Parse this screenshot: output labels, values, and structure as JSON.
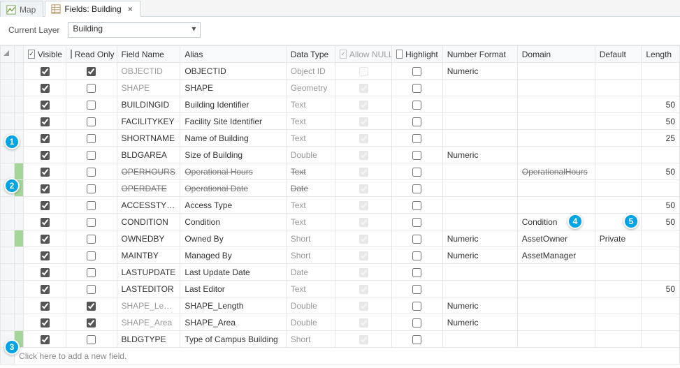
{
  "tabs": [
    {
      "label": "Map",
      "active": false
    },
    {
      "label": "Fields: Building",
      "active": true
    }
  ],
  "layer": {
    "label": "Current Layer",
    "value": "Building"
  },
  "columns": {
    "rowhdr": "",
    "visible": "Visible",
    "readonly": "Read Only",
    "fieldname": "Field Name",
    "alias": "Alias",
    "datatype": "Data Type",
    "allownull": "Allow NULL",
    "highlight": "Highlight",
    "numfmt": "Number Format",
    "domain": "Domain",
    "default": "Default",
    "length": "Length"
  },
  "rows": [
    {
      "gutter": "",
      "visible": true,
      "readonly": true,
      "fieldname": "OBJECTID",
      "alias": "OBJECTID",
      "datatype": "Object ID",
      "allownull": false,
      "allownullDisabled": true,
      "highlight": false,
      "numfmt": "Numeric",
      "domain": "",
      "default": "",
      "length": "",
      "fieldMuted": true,
      "typeMuted": true
    },
    {
      "gutter": "",
      "visible": true,
      "readonly": false,
      "fieldname": "SHAPE",
      "alias": "SHAPE",
      "datatype": "Geometry",
      "allownull": true,
      "allownullDisabled": true,
      "highlight": false,
      "numfmt": "",
      "domain": "",
      "default": "",
      "length": "",
      "fieldMuted": true,
      "typeMuted": true
    },
    {
      "gutter": "",
      "visible": true,
      "readonly": false,
      "fieldname": "BUILDINGID",
      "alias": "Building Identifier",
      "datatype": "Text",
      "allownull": true,
      "allownullDisabled": true,
      "highlight": false,
      "numfmt": "",
      "domain": "",
      "default": "",
      "length": "50",
      "typeMuted": true
    },
    {
      "gutter": "",
      "visible": true,
      "readonly": false,
      "fieldname": "FACILITYKEY",
      "alias": "Facility Site Identifier",
      "datatype": "Text",
      "allownull": true,
      "allownullDisabled": true,
      "highlight": false,
      "numfmt": "",
      "domain": "",
      "default": "",
      "length": "50",
      "typeMuted": true
    },
    {
      "gutter": "",
      "visible": true,
      "readonly": false,
      "fieldname": "SHORTNAME",
      "alias": "Name of Building",
      "datatype": "Text",
      "allownull": true,
      "allownullDisabled": true,
      "highlight": false,
      "numfmt": "",
      "domain": "",
      "default": "",
      "length": "25",
      "typeMuted": true
    },
    {
      "gutter": "",
      "visible": true,
      "readonly": false,
      "fieldname": "BLDGAREA",
      "alias": "Size of Building",
      "datatype": "Double",
      "allownull": true,
      "allownullDisabled": true,
      "highlight": false,
      "numfmt": "Numeric",
      "domain": "",
      "default": "",
      "length": "",
      "typeMuted": true
    },
    {
      "gutter": "green",
      "visible": true,
      "readonly": false,
      "fieldname": "OPERHOURS",
      "alias": "Operational Hours",
      "datatype": "Text",
      "allownull": true,
      "allownullDisabled": true,
      "highlight": false,
      "numfmt": "",
      "domain": "OperationalHours",
      "default": "",
      "length": "50",
      "strike": true
    },
    {
      "gutter": "green",
      "visible": true,
      "readonly": false,
      "fieldname": "OPERDATE",
      "alias": "Operational Date",
      "datatype": "Date",
      "allownull": true,
      "allownullDisabled": true,
      "highlight": false,
      "numfmt": "",
      "domain": "",
      "default": "",
      "length": "",
      "strike": true
    },
    {
      "gutter": "",
      "visible": true,
      "readonly": false,
      "fieldname": "ACCESSTYPE",
      "alias": "Access Type",
      "datatype": "Text",
      "allownull": true,
      "allownullDisabled": true,
      "highlight": false,
      "numfmt": "",
      "domain": "",
      "default": "",
      "length": "50",
      "typeMuted": true
    },
    {
      "gutter": "",
      "visible": true,
      "readonly": false,
      "fieldname": "CONDITION",
      "alias": "Condition",
      "datatype": "Text",
      "allownull": true,
      "allownullDisabled": true,
      "highlight": false,
      "numfmt": "",
      "domain": "Condition",
      "default": "",
      "length": "50",
      "typeMuted": true
    },
    {
      "gutter": "green",
      "visible": true,
      "readonly": false,
      "fieldname": "OWNEDBY",
      "alias": "Owned By",
      "datatype": "Short",
      "allownull": true,
      "allownullDisabled": true,
      "highlight": false,
      "numfmt": "Numeric",
      "domain": "AssetOwner",
      "default": "Private",
      "length": "",
      "typeMuted": true
    },
    {
      "gutter": "",
      "visible": true,
      "readonly": false,
      "fieldname": "MAINTBY",
      "alias": "Managed By",
      "datatype": "Short",
      "allownull": true,
      "allownullDisabled": true,
      "highlight": false,
      "numfmt": "Numeric",
      "domain": "AssetManager",
      "default": "",
      "length": "",
      "typeMuted": true
    },
    {
      "gutter": "",
      "visible": true,
      "readonly": false,
      "fieldname": "LASTUPDATE",
      "alias": "Last Update Date",
      "datatype": "Date",
      "allownull": true,
      "allownullDisabled": true,
      "highlight": false,
      "numfmt": "",
      "domain": "",
      "default": "",
      "length": "",
      "typeMuted": true
    },
    {
      "gutter": "",
      "visible": true,
      "readonly": false,
      "fieldname": "LASTEDITOR",
      "alias": "Last Editor",
      "datatype": "Text",
      "allownull": true,
      "allownullDisabled": true,
      "highlight": false,
      "numfmt": "",
      "domain": "",
      "default": "",
      "length": "50",
      "typeMuted": true
    },
    {
      "gutter": "",
      "visible": true,
      "readonly": true,
      "fieldname": "SHAPE_Length",
      "alias": "SHAPE_Length",
      "datatype": "Double",
      "allownull": true,
      "allownullDisabled": true,
      "highlight": false,
      "numfmt": "Numeric",
      "domain": "",
      "default": "",
      "length": "",
      "fieldMuted": true,
      "typeMuted": true
    },
    {
      "gutter": "",
      "visible": true,
      "readonly": true,
      "fieldname": "SHAPE_Area",
      "alias": "SHAPE_Area",
      "datatype": "Double",
      "allownull": true,
      "allownullDisabled": true,
      "highlight": false,
      "numfmt": "Numeric",
      "domain": "",
      "default": "",
      "length": "",
      "fieldMuted": true,
      "typeMuted": true
    },
    {
      "gutter": "green",
      "visible": true,
      "readonly": false,
      "fieldname": "BLDGTYPE",
      "alias": "Type of Campus Building",
      "datatype": "Short",
      "allownull": true,
      "allownullDisabled": true,
      "highlight": false,
      "numfmt": "",
      "domain": "",
      "default": "",
      "length": "",
      "typeMuted": true
    }
  ],
  "newRowText": "Click here to add a new field.",
  "badges": [
    "1",
    "2",
    "3",
    "4",
    "5"
  ]
}
